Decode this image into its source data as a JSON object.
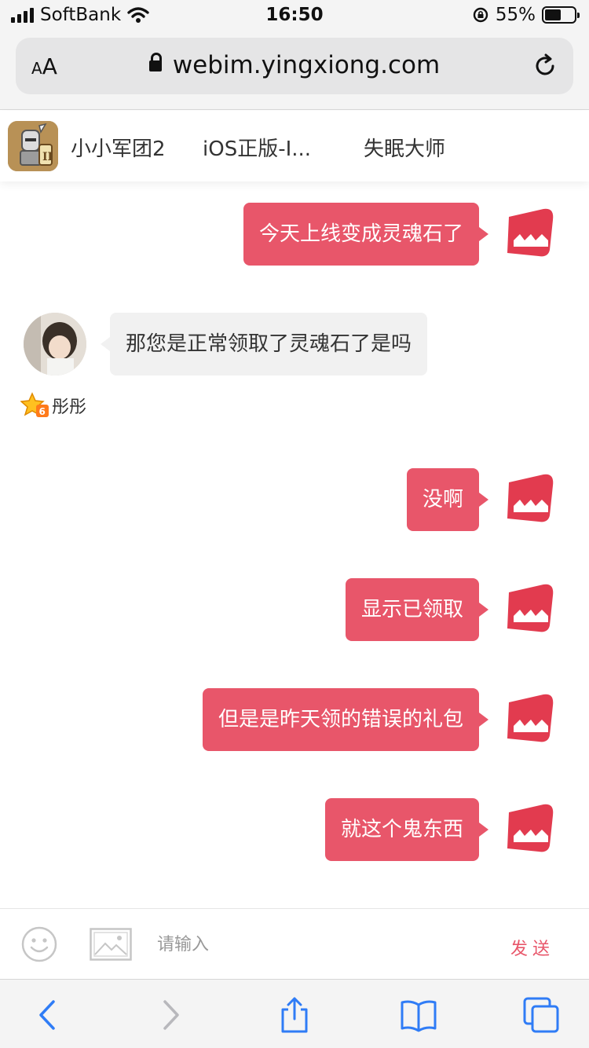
{
  "status_bar": {
    "carrier": "SoftBank",
    "time": "16:50",
    "battery_percent": "55%",
    "battery_level": 0.55
  },
  "browser": {
    "text_size_label_small": "A",
    "text_size_label_large": "A",
    "url": "webim.yingxiong.com"
  },
  "tabs": [
    {
      "label": "小小军团2"
    },
    {
      "label": "iOS正版-I..."
    },
    {
      "label": "失眠大师"
    }
  ],
  "chat": {
    "messages": [
      {
        "side": "out",
        "text": "今天上线变成灵魂石了"
      },
      {
        "side": "in",
        "text": "那您是正常领取了灵魂石了是吗",
        "agent_name": "彤彤"
      },
      {
        "side": "out",
        "text": "没啊"
      },
      {
        "side": "out",
        "text": "显示已领取"
      },
      {
        "side": "out",
        "text": "但是是昨天领的错误的礼包"
      },
      {
        "side": "out",
        "text": "就这个鬼东西"
      }
    ]
  },
  "composer": {
    "placeholder": "请输入",
    "send_label": "发送"
  },
  "colors": {
    "accent": "#e8566a",
    "incoming_bubble": "#f1f1f1",
    "ios_blue": "#2f7cf6"
  },
  "icons": {
    "signal": "signal-bars-icon",
    "wifi": "wifi-icon",
    "orientation_lock": "orientation-lock-icon",
    "battery": "battery-icon",
    "lock": "lock-icon",
    "reload": "reload-icon",
    "emoji": "emoji-icon",
    "image": "image-icon",
    "back": "chevron-left-icon",
    "forward": "chevron-right-icon",
    "share": "share-icon",
    "bookmarks": "book-icon",
    "tabs": "tabs-icon"
  }
}
